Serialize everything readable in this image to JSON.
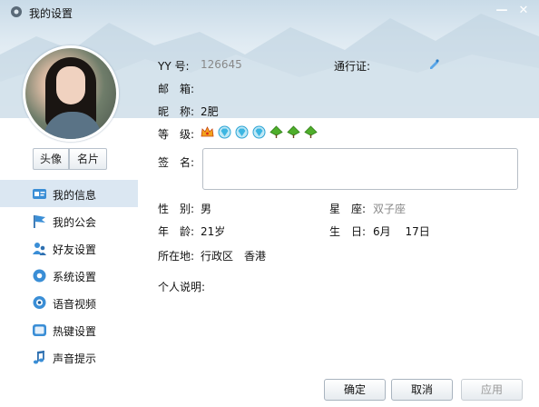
{
  "window": {
    "title": "我的设置",
    "minimize_label": "—",
    "close_label": "✕"
  },
  "sidebar": {
    "tabs": [
      {
        "label": "头像"
      },
      {
        "label": "名片"
      }
    ],
    "items": [
      {
        "label": "我的信息",
        "icon": "id-card-icon",
        "active": true
      },
      {
        "label": "我的公会",
        "icon": "flag-icon"
      },
      {
        "label": "好友设置",
        "icon": "friends-icon"
      },
      {
        "label": "系统设置",
        "icon": "gear-icon"
      },
      {
        "label": "语音视频",
        "icon": "webcam-icon"
      },
      {
        "label": "热键设置",
        "icon": "keyboard-icon"
      },
      {
        "label": "声音提示",
        "icon": "music-note-icon"
      }
    ]
  },
  "profile": {
    "yy_label": "YY 号:",
    "yy_value": "126645",
    "passport_label": "通行证:",
    "email_label": "邮　箱:",
    "nickname_label": "昵　称:",
    "nickname_value": "2肥",
    "level_label": "等　级:",
    "level_icons": [
      "crown-icon",
      "diamond-icon",
      "diamond-icon",
      "diamond-icon",
      "leaf-icon",
      "leaf-icon",
      "leaf-icon"
    ],
    "signature_label": "签　名:",
    "gender_label": "性　别:",
    "gender_value": "男",
    "zodiac_label": "星　座:",
    "zodiac_value": "双子座",
    "age_label": "年　龄:",
    "age_value": "21岁",
    "birthday_label": "生　日:",
    "birthday_value": "6月　 17日",
    "location_label": "所在地:",
    "location_value": "行政区　香港",
    "bio_label": "个人说明:"
  },
  "footer": {
    "ok_label": "确定",
    "cancel_label": "取消",
    "apply_label": "应用"
  },
  "colors": {
    "accent": "#dbe7f2",
    "icon_blue": "#3a8ed6"
  }
}
